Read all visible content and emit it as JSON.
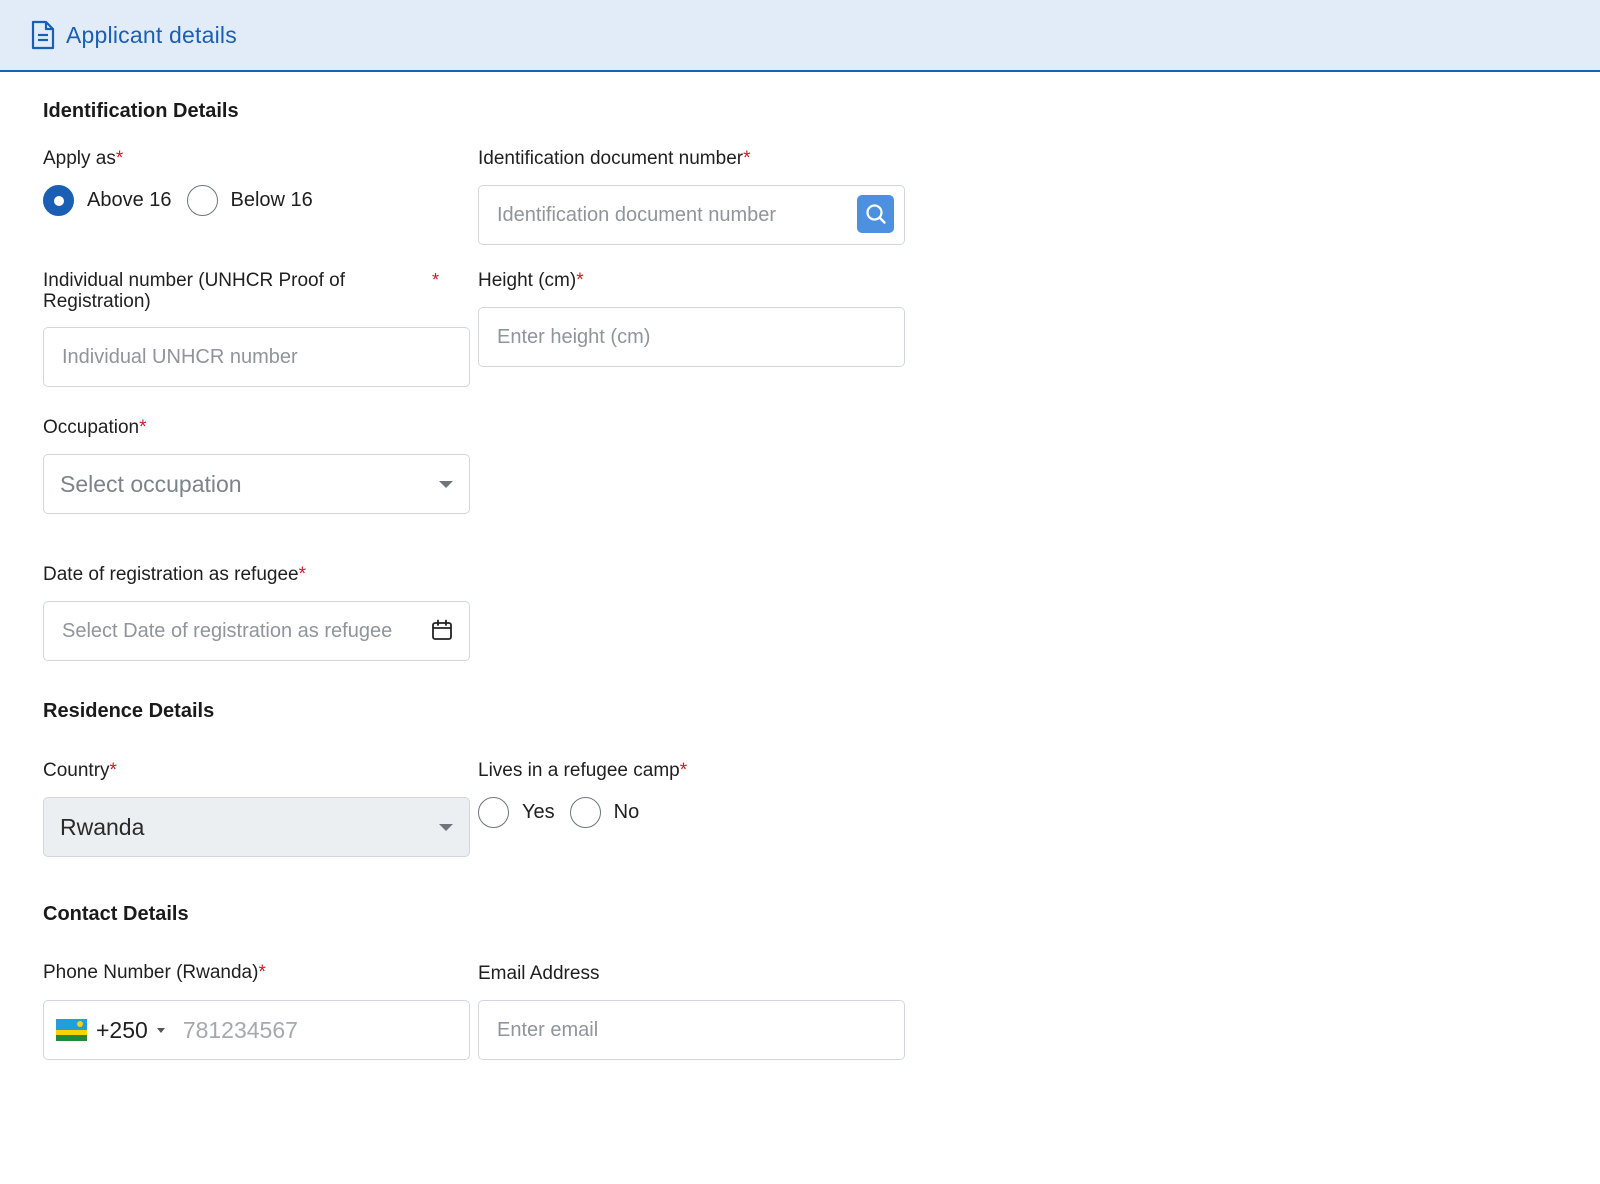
{
  "header": {
    "title": "Applicant details",
    "icon": "document-icon"
  },
  "identification": {
    "title": "Identification Details",
    "apply_as": {
      "label": "Apply as",
      "options": [
        "Above 16",
        "Below 16"
      ],
      "selected": "Above 16"
    },
    "id_doc": {
      "label": "Identification document number",
      "placeholder": "Identification document number"
    },
    "unhcr": {
      "label": "Individual number (UNHCR Proof of Registration)",
      "placeholder": "Individual UNHCR number"
    },
    "height": {
      "label": "Height (cm)",
      "placeholder": "Enter height (cm)"
    },
    "occupation": {
      "label": "Occupation",
      "placeholder": "Select occupation"
    },
    "registration_date": {
      "label": "Date of registration as refugee",
      "placeholder": "Select Date of registration as refugee"
    }
  },
  "residence": {
    "title": "Residence Details",
    "country": {
      "label": "Country",
      "value": "Rwanda"
    },
    "refugee_camp": {
      "label": "Lives in a refugee camp",
      "options": [
        "Yes",
        "No"
      ]
    }
  },
  "contact": {
    "title": "Contact Details",
    "phone": {
      "label": "Phone Number (Rwanda)",
      "dial_code": "+250",
      "placeholder": "781234567"
    },
    "email": {
      "label": "Email Address",
      "placeholder": "Enter email"
    }
  },
  "required_mark": "*",
  "colors": {
    "accent": "#1a5fb4",
    "header_bg": "#e2ecf8",
    "required": "#d11a2a",
    "search_button": "#4d90e0"
  }
}
